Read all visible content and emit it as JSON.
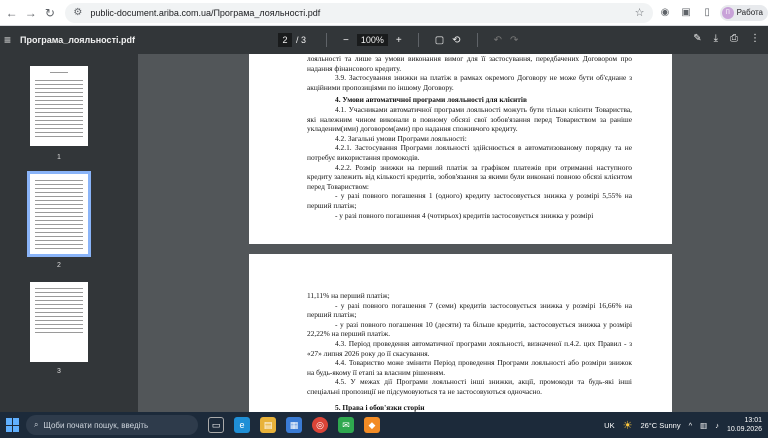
{
  "browser": {
    "url": "public-document.ariba.com.ua/Програма_лояльності.pdf",
    "profile_label": "Работа",
    "profile_initial": "П"
  },
  "pdf": {
    "title": "Програма_лояльності.pdf",
    "current_page": "2",
    "total_pages": "/ 3",
    "zoom": "100%",
    "thumbnails": [
      "1",
      "2",
      "3"
    ]
  },
  "page2_lines": [
    "лояльності та лише за умови виконання вимог для її застосування, передбачених Договором про надання фінансового кредиту.",
    "3.9. Застосування знижки на платіж в рамках окремого Договору не може бути об'єднане з акційними пропозиціями по іншому Договору.",
    "4.     Умови автоматичної програми лояльності для клієнтів",
    "4.1. Учасниками автоматичної програми лояльності можуть бути тільки клієнти Товариства, які належним чином виконали в повному обсязі свої зобов'язання перед Товариством за раніше укладеним(ими) договором(ами) про надання споживчого кредиту.",
    "4.2. Загальні умови Програми лояльності:",
    "4.2.1. Застосування Програми лояльності здійснюється в автоматизованому порядку та не потребує використання промокодів.",
    "4.2.2. Розмір знижки на перший платіж за графіком платежів при отриманні наступного кредиту залежить від кількості кредитів, зобов'язання за якими були виконані повною обсязі клієнтом перед Товариством:",
    "- у разі повного погашення 1 (одного) кредиту застосовується знижка у розмірі 5,55% на перший платіж;",
    "- у разі повного погашення 4 (чотирьох) кредитів застосовується знижка у розмірі"
  ],
  "page3_lines": [
    "11,11% на перший платіж;",
    "- у разі повного погашення 7 (семи) кредитів застосовується знижка у розмірі 16,66% на перший платіж;",
    "- у разі повного погашення 10 (десяти) та більше кредитів, застосовується знижка у розмірі 22,22% на перший платіж.",
    "4.3. Період проведення автоматичної програми лояльності, визначеної п.4.2. цих Правил - з «27» липня 2026 року до її скасування.",
    "4.4. Товариство може змінити Період проведення Програми лояльності або розміри знижок на будь-якому її етапі за власним рішенням.",
    "4.5. У межах дії Програми лояльності інші знижки, акції, промокоди та будь-які інші спеціальні пропозиції не підсумовуються та не застосовуються одночасно.",
    "5.   Права і обов'язки сторін"
  ],
  "taskbar": {
    "search_placeholder": "Щоби почати пошук, введіть",
    "lang": "UK",
    "weather": "26°C  Sunny",
    "time": "13:01",
    "date": "10.09.2026"
  }
}
